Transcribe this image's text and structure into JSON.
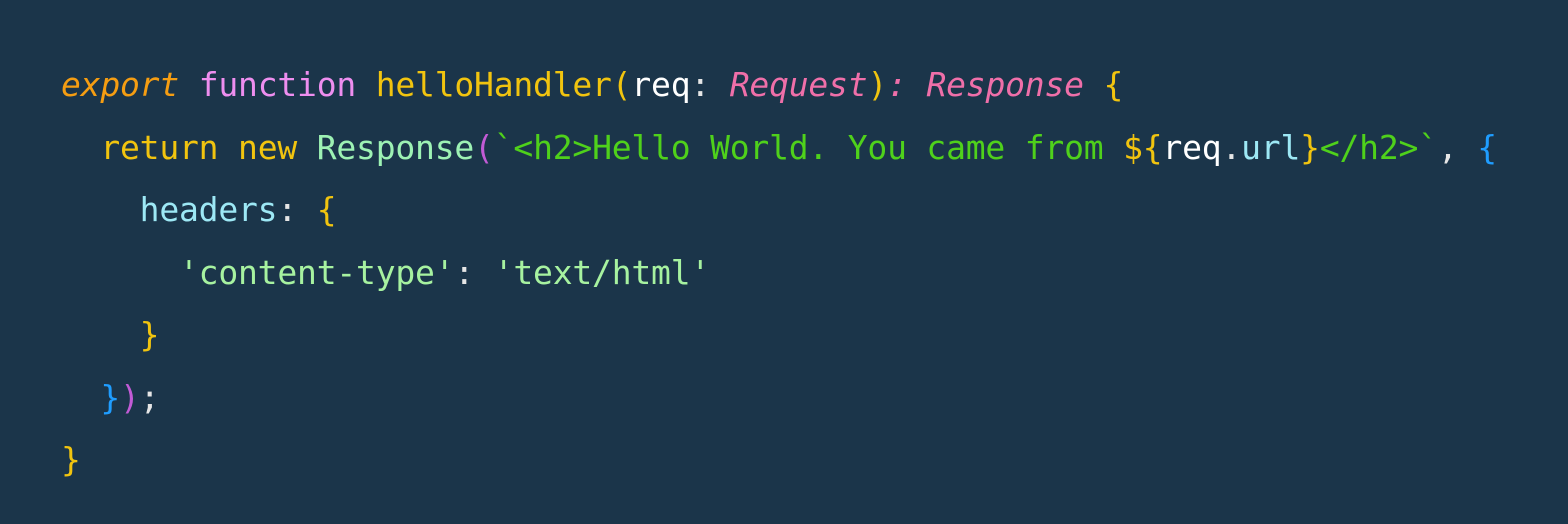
{
  "code": {
    "language": "typescript",
    "colors": {
      "background": "#1b354a",
      "keyword_export": "#f59d12",
      "keyword_function": "#ee8eef",
      "keyword_flow": "#f1c40f",
      "function_name": "#f1c40f",
      "identifier": "#ffffff",
      "type": "#ef6fa9",
      "class_name": "#9df2b4",
      "property": "#9de8f5",
      "string": "#a7f2a0",
      "template_string": "#4fd11b",
      "punctuation": "#e6e6e6",
      "bracket_level_1": "#f1c40f",
      "bracket_level_2": "#c25bd6",
      "bracket_level_3": "#1f9dff"
    },
    "lines": [
      {
        "indent": "",
        "tokens": [
          {
            "text": "export",
            "color": "#f59d12",
            "style": "italic"
          },
          {
            "text": " ",
            "color": "#e6e6e6"
          },
          {
            "text": "function",
            "color": "#ee8eef"
          },
          {
            "text": " ",
            "color": "#e6e6e6"
          },
          {
            "text": "helloHandler",
            "color": "#f1c40f"
          },
          {
            "text": "(",
            "color": "#f1c40f"
          },
          {
            "text": "req",
            "color": "#ffffff"
          },
          {
            "text": ": ",
            "color": "#e6e6e6"
          },
          {
            "text": "Request",
            "color": "#ef6fa9",
            "style": "italic"
          },
          {
            "text": ")",
            "color": "#f1c40f"
          },
          {
            "text": ": ",
            "color": "#ef6fa9",
            "style": "italic"
          },
          {
            "text": "Response",
            "color": "#ef6fa9",
            "style": "italic"
          },
          {
            "text": " ",
            "color": "#e6e6e6"
          },
          {
            "text": "{",
            "color": "#f1c40f"
          }
        ]
      },
      {
        "indent": "  ",
        "tokens": [
          {
            "text": "return",
            "color": "#f1c40f"
          },
          {
            "text": " ",
            "color": "#e6e6e6"
          },
          {
            "text": "new",
            "color": "#f1c40f"
          },
          {
            "text": " ",
            "color": "#e6e6e6"
          },
          {
            "text": "Response",
            "color": "#9df2b4"
          },
          {
            "text": "(",
            "color": "#c25bd6"
          },
          {
            "text": "`<h2>Hello World. You came from ",
            "color": "#4fd11b"
          },
          {
            "text": "${",
            "color": "#f1c40f"
          },
          {
            "text": "req",
            "color": "#ffffff"
          },
          {
            "text": ".",
            "color": "#e6e6e6"
          },
          {
            "text": "url",
            "color": "#9de8f5"
          },
          {
            "text": "}",
            "color": "#f1c40f"
          },
          {
            "text": "</h2>`",
            "color": "#4fd11b"
          },
          {
            "text": ", ",
            "color": "#e6e6e6"
          },
          {
            "text": "{",
            "color": "#1f9dff"
          }
        ]
      },
      {
        "indent": "    ",
        "tokens": [
          {
            "text": "headers",
            "color": "#9de8f5"
          },
          {
            "text": ": ",
            "color": "#e6e6e6"
          },
          {
            "text": "{",
            "color": "#f1c40f"
          }
        ]
      },
      {
        "indent": "      ",
        "tokens": [
          {
            "text": "'content-type'",
            "color": "#a7f2a0"
          },
          {
            "text": ": ",
            "color": "#e6e6e6"
          },
          {
            "text": "'text/html'",
            "color": "#a7f2a0"
          }
        ]
      },
      {
        "indent": "    ",
        "tokens": [
          {
            "text": "}",
            "color": "#f1c40f"
          }
        ]
      },
      {
        "indent": "  ",
        "tokens": [
          {
            "text": "}",
            "color": "#1f9dff"
          },
          {
            "text": ")",
            "color": "#c25bd6"
          },
          {
            "text": ";",
            "color": "#e6e6e6"
          }
        ]
      },
      {
        "indent": "",
        "tokens": [
          {
            "text": "}",
            "color": "#f1c40f"
          }
        ]
      }
    ]
  }
}
